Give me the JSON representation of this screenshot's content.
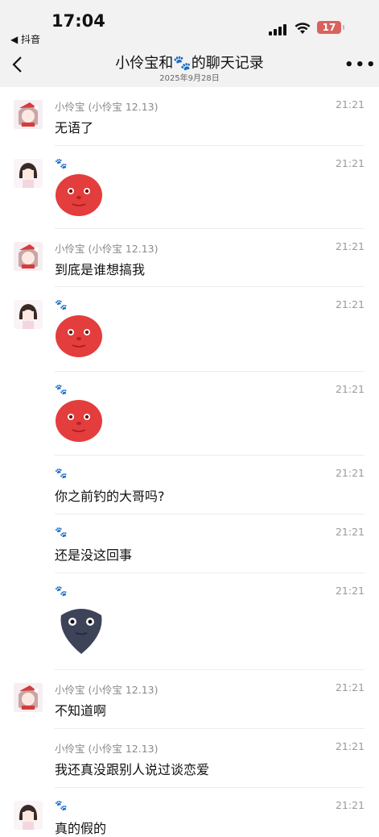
{
  "status_bar": {
    "time": "17:04",
    "back_app": "◀ 抖音",
    "battery": "17"
  },
  "nav": {
    "title": "小伶宝和🐾的聊天记录",
    "date": "2025年9月28日"
  },
  "messages": [
    {
      "sender": "小伶宝 (小伶宝 12.13)",
      "time": "21:21",
      "text": "无语了"
    },
    {
      "sender": "🐾",
      "time": "21:21",
      "sticker": "red-face"
    },
    {
      "sender": "小伶宝 (小伶宝 12.13)",
      "time": "21:21",
      "text": "到底是谁想搞我"
    },
    {
      "sender": "🐾",
      "time": "21:21",
      "sticker": "red-face"
    },
    {
      "sender": "🐾",
      "time": "21:21",
      "sticker": "red-face"
    },
    {
      "sender": "🐾",
      "time": "21:21",
      "text": "你之前钓的大哥吗?"
    },
    {
      "sender": "🐾",
      "time": "21:21",
      "text": "还是没这回事"
    },
    {
      "sender": "🐾",
      "time": "21:21",
      "sticker": "dark-face"
    },
    {
      "sender": "小伶宝 (小伶宝 12.13)",
      "time": "21:21",
      "text": "不知道啊"
    },
    {
      "sender": "小伶宝 (小伶宝 12.13)",
      "time": "21:21",
      "text": "我还真没跟别人说过谈恋爱"
    },
    {
      "sender": "🐾",
      "time": "21:21",
      "text": "真的假的"
    }
  ]
}
